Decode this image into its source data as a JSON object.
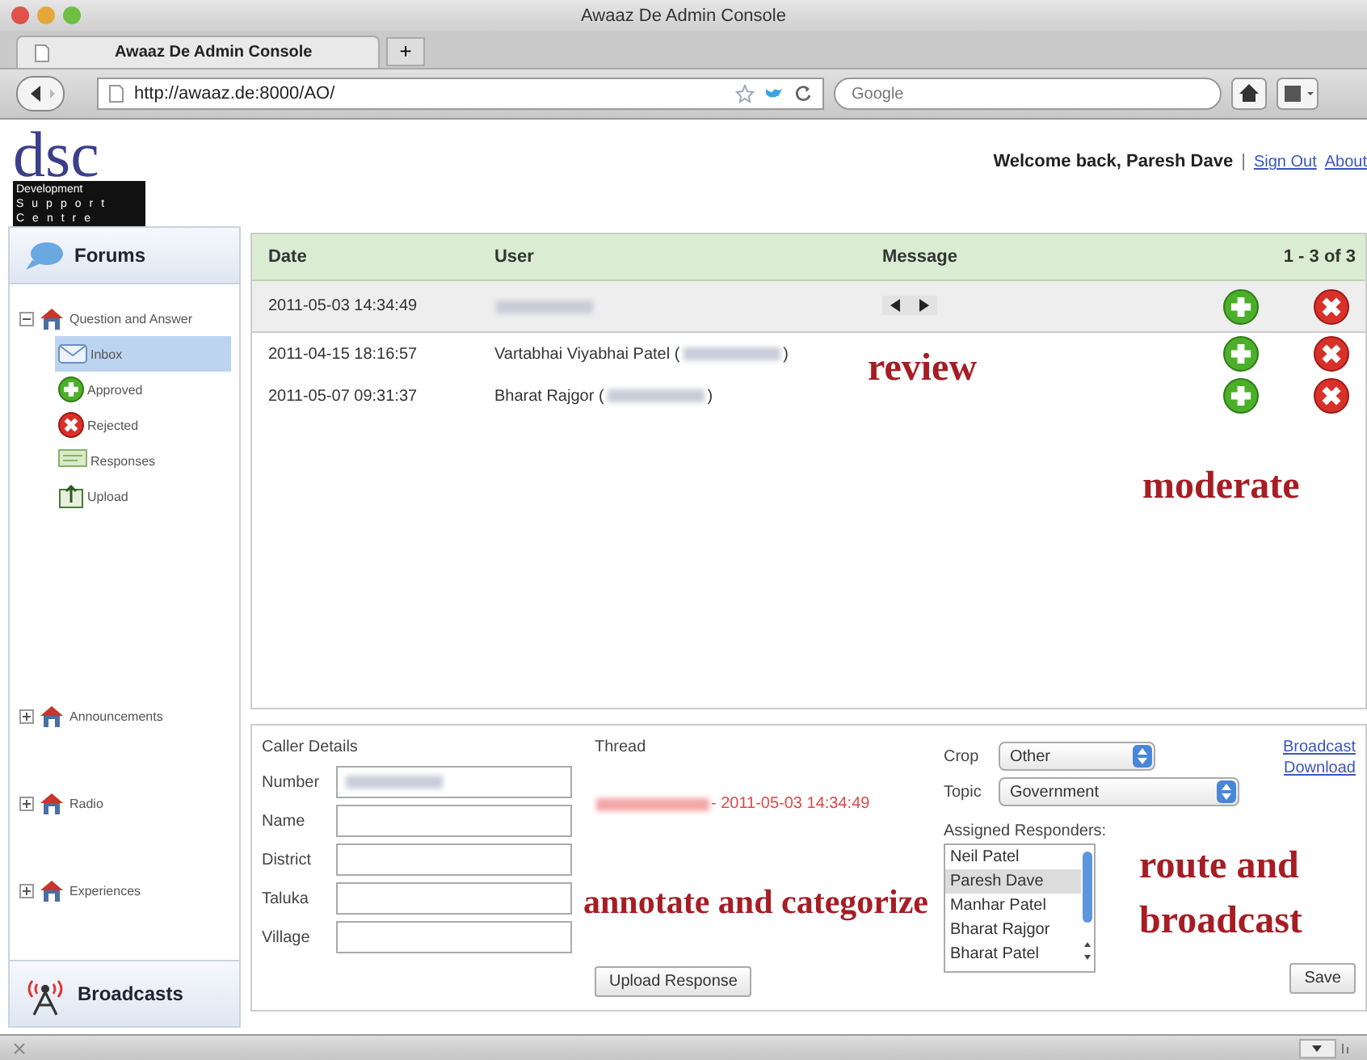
{
  "window": {
    "title": "Awaaz De Admin Console"
  },
  "browser": {
    "tab": "Awaaz De Admin Console",
    "new_tab": "+",
    "url": "http://awaaz.de:8000/AO/",
    "search": {
      "placeholder": "Google"
    }
  },
  "logo": {
    "mark": "dsc",
    "lines": [
      "Development",
      "Support",
      "Centre"
    ]
  },
  "header": {
    "welcome": "Welcome back, Paresh Dave",
    "separator": "|",
    "links": [
      "Sign Out",
      "About"
    ]
  },
  "sidebar": {
    "top": "Forums",
    "groups": [
      {
        "label": "Question and Answer",
        "expanded": true,
        "children": [
          {
            "label": "Inbox",
            "kind": "inbox",
            "selected": true
          },
          {
            "label": "Approved",
            "kind": "approved",
            "selected": false
          },
          {
            "label": "Rejected",
            "kind": "rejected",
            "selected": false
          },
          {
            "label": "Responses",
            "kind": "responses",
            "selected": false
          },
          {
            "label": "Upload",
            "kind": "upload",
            "selected": false
          }
        ]
      },
      {
        "label": "Announcements",
        "expanded": false
      },
      {
        "label": "Radio",
        "expanded": false
      },
      {
        "label": "Experiences",
        "expanded": false
      }
    ],
    "bottom": "Broadcasts"
  },
  "table": {
    "columns": [
      "Date",
      "User",
      "Message"
    ],
    "count": "1 - 3 of 3",
    "rows": [
      {
        "date": "2011-05-03 14:34:49",
        "selected": true,
        "redacted": true
      },
      {
        "date": "2011-04-15 18:16:57",
        "user": "Vartabhai Viyabhai Patel (",
        "user_end": ")",
        "selected": false,
        "redacted": true
      },
      {
        "date": "2011-05-07 09:31:37",
        "user": "Bharat Rajgor (",
        "user_end": ")",
        "selected": false,
        "redacted": true
      }
    ]
  },
  "details": {
    "title": "Caller Details",
    "fields": [
      {
        "label": "Number",
        "redacted": true
      },
      {
        "label": "Name"
      },
      {
        "label": "District"
      },
      {
        "label": "Taluka"
      },
      {
        "label": "Village"
      }
    ],
    "thread": {
      "title": "Thread",
      "entry": "- 2011-05-03 14:34:49",
      "button": "Upload Response"
    },
    "crop": {
      "label": "Crop",
      "value": "Other"
    },
    "topic": {
      "label": "Topic",
      "value": "Government"
    },
    "responders": {
      "label": "Assigned Responders:",
      "items": [
        {
          "name": "Neil Patel",
          "selected": false
        },
        {
          "name": "Paresh Dave",
          "selected": true
        },
        {
          "name": "Manhar Patel",
          "selected": false
        },
        {
          "name": "Bharat Rajgor",
          "selected": false
        },
        {
          "name": "Bharat Patel",
          "selected": false
        }
      ]
    },
    "links": [
      "Broadcast",
      "Download"
    ],
    "save": "Save"
  },
  "annotations": [
    {
      "text": "review"
    },
    {
      "text": "moderate"
    },
    {
      "text": "annotate and categorize"
    },
    {
      "text": "route and"
    },
    {
      "text": "broadcast"
    }
  ]
}
